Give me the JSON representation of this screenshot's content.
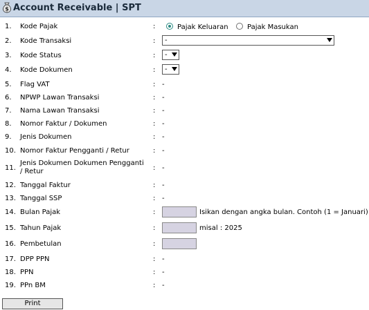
{
  "header": {
    "title": "Account Receivable | SPT",
    "icon": "money-bag-icon"
  },
  "rows": [
    {
      "num": "1.",
      "label": "Kode Pajak"
    },
    {
      "num": "2.",
      "label": "Kode Transaksi"
    },
    {
      "num": "3.",
      "label": "Kode Status"
    },
    {
      "num": "4.",
      "label": "Kode Dokumen"
    },
    {
      "num": "5.",
      "label": "Flag VAT"
    },
    {
      "num": "6.",
      "label": "NPWP Lawan Transaksi"
    },
    {
      "num": "7.",
      "label": "Nama Lawan Transaksi"
    },
    {
      "num": "8.",
      "label": "Nomor Faktur / Dokumen"
    },
    {
      "num": "9.",
      "label": "Jenis Dokumen"
    },
    {
      "num": "10.",
      "label": "Nomor Faktur Pengganti / Retur"
    },
    {
      "num": "11.",
      "label": "Jenis Dokumen Dokumen Pengganti / Retur"
    },
    {
      "num": "12.",
      "label": "Tanggal Faktur"
    },
    {
      "num": "13.",
      "label": "Tanggal SSP"
    },
    {
      "num": "14.",
      "label": "Bulan Pajak"
    },
    {
      "num": "15.",
      "label": "Tahun Pajak"
    },
    {
      "num": "16.",
      "label": "Pembetulan"
    },
    {
      "num": "17.",
      "label": "DPP PPN"
    },
    {
      "num": "18.",
      "label": "PPN"
    },
    {
      "num": "19.",
      "label": "PPn BM"
    }
  ],
  "colon": ":",
  "dash": "-",
  "kode_pajak": {
    "options": [
      {
        "label": "Pajak Keluaran",
        "checked": true
      },
      {
        "label": "Pajak Masukan",
        "checked": false
      }
    ]
  },
  "kode_transaksi": {
    "selected": "-"
  },
  "kode_status": {
    "selected": "-"
  },
  "kode_dokumen": {
    "selected": "-"
  },
  "bulan_pajak": {
    "value": "",
    "hint": "Isikan dengan angka bulan. Contoh (1 = Januari)"
  },
  "tahun_pajak": {
    "value": "",
    "hint": "misal : 2025"
  },
  "pembetulan": {
    "value": ""
  },
  "print_button": {
    "label": "Print"
  },
  "colors": {
    "header_bg": "#c9d6e6",
    "input_bg": "#d6d3e2",
    "radio_accent": "#2a8a82"
  }
}
